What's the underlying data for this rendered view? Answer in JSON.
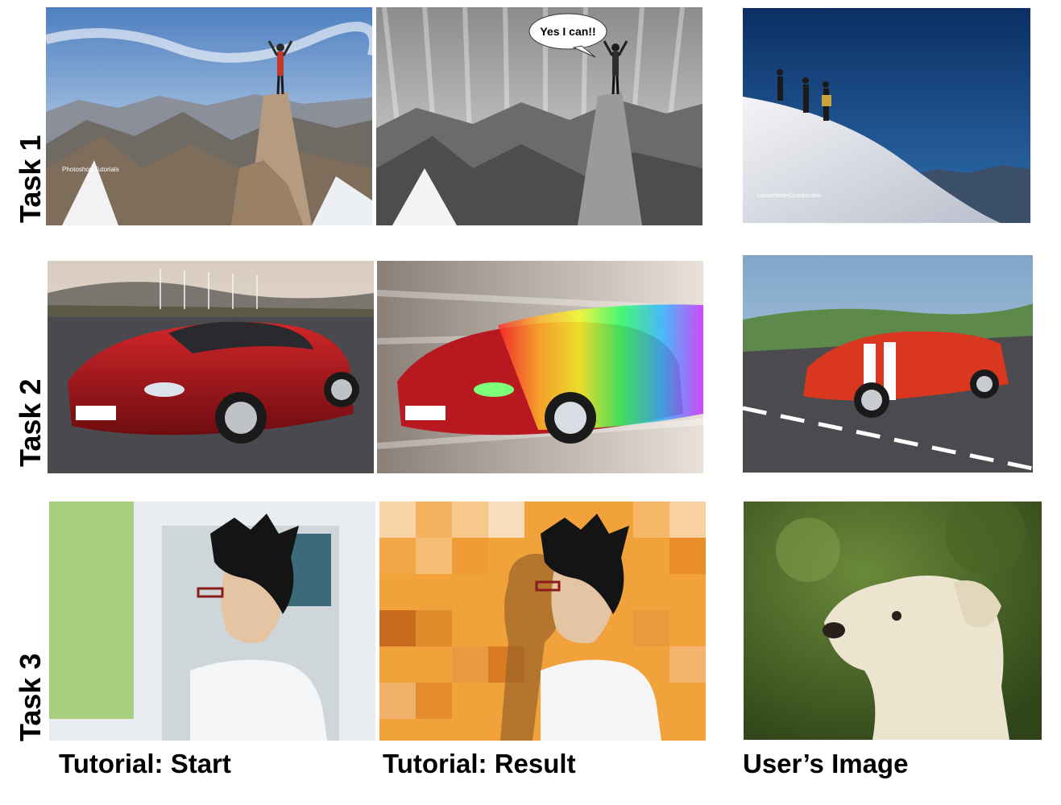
{
  "rows": [
    {
      "label": "Task 1"
    },
    {
      "label": "Task 2"
    },
    {
      "label": "Task 3"
    }
  ],
  "columns": [
    {
      "label": "Tutorial: Start"
    },
    {
      "label": "Tutorial: Result"
    },
    {
      "label": "User’s Image"
    }
  ],
  "annotations": {
    "task1_start_watermark": "Photoshop Tutorials",
    "task1_result_speech": "Yes I can!!",
    "task1_user_watermark": "Lenzerheide|Graubünden"
  },
  "icons": {
    "speech_bubble": "speech-bubble-icon"
  },
  "colors": {
    "text": "#000000",
    "background": "#ffffff"
  }
}
